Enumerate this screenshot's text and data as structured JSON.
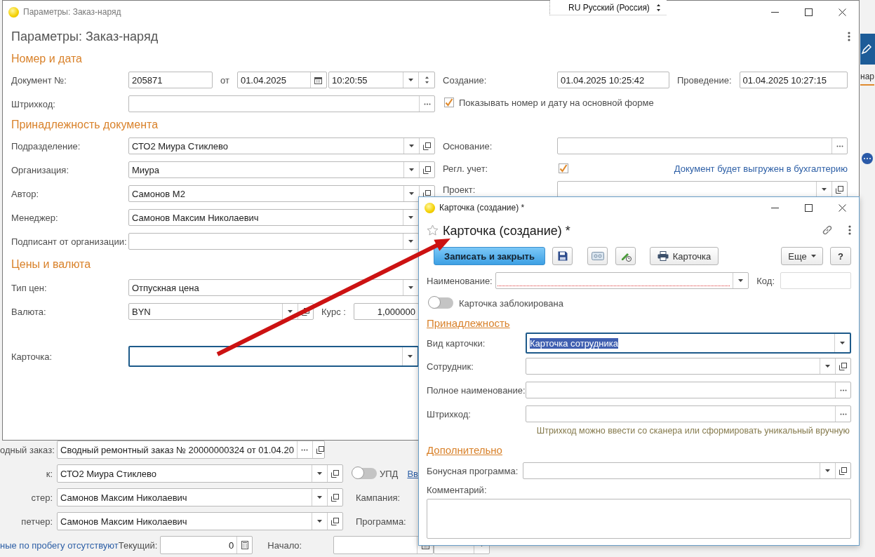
{
  "language_bar": {
    "label": "RU Русский (Россия)"
  },
  "background_app": {
    "tab_label": "нар",
    "rows": [
      {
        "kind": "choice_ref",
        "label": "одный заказ:",
        "value": "Сводный ремонтный заказ № 20000000324 от 01.04.20"
      },
      {
        "kind": "ref",
        "label": "к:",
        "value": "СТО2 Миура Стиклево",
        "toggle": {
          "label": "УПД",
          "on": false
        },
        "link": "Вв"
      },
      {
        "kind": "ref",
        "label": "стер:",
        "value": "Самонов Максим Николаевич",
        "side_label": "Кампания:"
      },
      {
        "kind": "ref",
        "label": "петчер:",
        "value": "Самонов Максим Николаевич",
        "side_label": "Программа:"
      }
    ],
    "mileage": {
      "link": "ные по пробегу отсутствуют",
      "current_label": "Текущий:",
      "current_value": "0",
      "start_label": "Начало:"
    }
  },
  "main_window": {
    "title": "Параметры: Заказ-наряд",
    "heading": "Параметры: Заказ-наряд",
    "left": [
      {
        "kind": "section",
        "text": "Номер и дата"
      },
      {
        "kind": "doc_number",
        "label": "Документ №:",
        "number": "205871",
        "sep": "от",
        "date": "01.04.2025",
        "time": "10:20:55"
      },
      {
        "kind": "choice",
        "label": "Штрихкод:"
      },
      {
        "kind": "section",
        "text": "Принадлежность документа"
      },
      {
        "kind": "ref",
        "label": "Подразделение:",
        "value": "СТО2 Миура Стиклево"
      },
      {
        "kind": "ref",
        "label": "Организация:",
        "value": "Миура"
      },
      {
        "kind": "ref",
        "label": "Автор:",
        "value": "Самонов М2"
      },
      {
        "kind": "select",
        "label": "Менеджер:",
        "value": "Самонов Максим Николаевич"
      },
      {
        "kind": "select",
        "label": "Подписант от организации:"
      },
      {
        "kind": "section",
        "text": "Цены и валюта"
      },
      {
        "kind": "select",
        "label": "Тип цен:",
        "value": "Отпускная цена"
      },
      {
        "kind": "currency",
        "label": "Валюта:",
        "value": "BYN",
        "rate_label": "Курс :",
        "rate": "1,000000"
      },
      {
        "kind": "select",
        "label": "Карточка:",
        "focused": true
      }
    ],
    "right": [
      {
        "kind": "datetime_pair",
        "label": "Создание:",
        "value": "01.04.2025 10:25:42",
        "label2": "Проведение:",
        "value2": "01.04.2025 10:27:15"
      },
      {
        "kind": "checkbox",
        "label": "Показывать номер и дату на основной форме",
        "checked": true
      },
      {
        "kind": "choice",
        "label": "Основание:"
      },
      {
        "kind": "check_field",
        "label": "Регл. учет:",
        "checked": true,
        "link": "Документ будет выгружен в бухгалтерию"
      },
      {
        "kind": "ref",
        "label": "Проект:"
      }
    ]
  },
  "dialog": {
    "title": "Карточка (создание) *",
    "heading": "Карточка (создание) *",
    "toolbar": [
      {
        "kind": "primary",
        "label": "Записать и закрыть"
      },
      {
        "kind": "save"
      },
      {
        "kind": "card_reader"
      },
      {
        "kind": "edit_history"
      },
      {
        "kind": "print",
        "label": "Карточка"
      },
      {
        "kind": "more",
        "label": "Еще"
      },
      {
        "kind": "help",
        "label": "?"
      }
    ],
    "name_field": {
      "kind": "select",
      "label": "Наименование:",
      "required": true
    },
    "code_field": {
      "label": "Код:"
    },
    "locked_toggle": {
      "label": "Карточка заблокирована",
      "on": false
    },
    "sections": [
      {
        "title": "Принадлежность",
        "rows": [
          {
            "kind": "select",
            "label": "Вид карточки:",
            "value": "Карточка сотрудника",
            "focused": true,
            "text_selected": true
          },
          {
            "kind": "ref",
            "label": "Сотрудник:"
          },
          {
            "kind": "choice",
            "label": "Полное наименование:"
          },
          {
            "kind": "choice",
            "label": "Штрихкод:",
            "hint": "Штрихкод можно ввести со сканера или сформировать уникальный вручную"
          }
        ]
      },
      {
        "title": "Дополнительно",
        "rows": [
          {
            "kind": "ref",
            "label": "Бонусная программа:"
          }
        ]
      }
    ],
    "comment": {
      "label": "Комментарий:"
    }
  }
}
